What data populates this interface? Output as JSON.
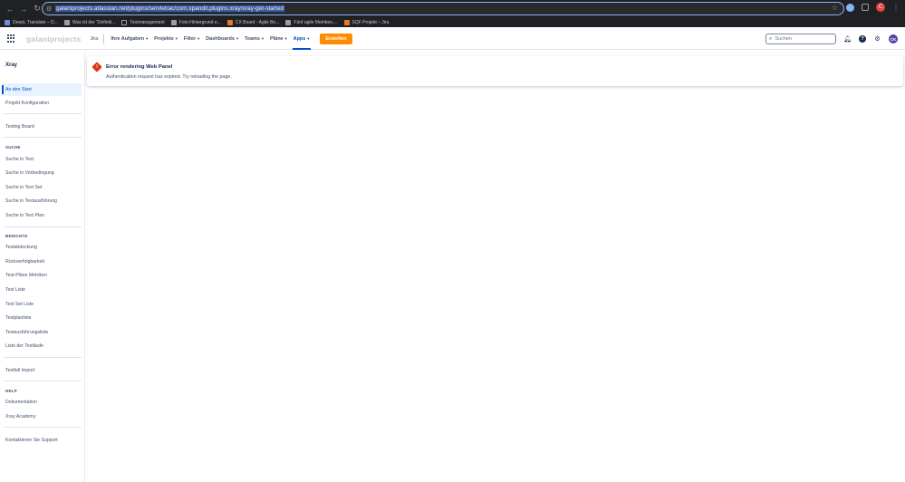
{
  "browser": {
    "url": "galaniprojects.atlassian.net/plugins/servlet/ac/com.xpandit.plugins.xray/xray-get-started",
    "profile_initial": "C",
    "bookmarks": [
      {
        "label": "DeepL Translate – D...",
        "icon": "deepl-icon"
      },
      {
        "label": "Was ist der \"Definiti...",
        "icon": "page-icon"
      },
      {
        "label": "Testmanagement",
        "icon": "folder-icon"
      },
      {
        "label": "Foto-Hintergrund e...",
        "icon": "scale-icon"
      },
      {
        "label": "CX Board - Agile Bo...",
        "icon": "jira-icon"
      },
      {
        "label": "Fünf agile Metriken,...",
        "icon": "page-icon"
      },
      {
        "label": "SQF Projekt – Jira",
        "icon": "jira-icon"
      }
    ]
  },
  "header": {
    "brand": "galaniprojects",
    "product": "Jira",
    "menu": [
      {
        "label": "Ihre Aufgaben",
        "active": false
      },
      {
        "label": "Projekte",
        "active": false
      },
      {
        "label": "Filter",
        "active": false
      },
      {
        "label": "Dashboards",
        "active": false
      },
      {
        "label": "Teams",
        "active": false
      },
      {
        "label": "Pläne",
        "active": false
      },
      {
        "label": "Apps",
        "active": true
      }
    ],
    "create_label": "Erstellen",
    "search_placeholder": "Suchen",
    "avatar_initials": "CK"
  },
  "sidebar": {
    "title": "Xray",
    "items_top": [
      {
        "label": "An den Start",
        "active": true
      },
      {
        "label": "Projekt Konfiguration"
      }
    ],
    "testing_board": "Testing Board",
    "search_heading": "SUCHE",
    "search_items": [
      "Suche in Test",
      "Suche in Vorbedingung",
      "Suche in Test Set",
      "Suche in Testausführung",
      "Suche in Test Plan"
    ],
    "reports_heading": "BERICHTE",
    "report_items": [
      "Testabdeckung",
      "Rückverfolgbarkeit",
      "Test-Pläne Metriken",
      "Test Liste",
      "Test Set Liste",
      "Testplanliste",
      "Testausführungsliste",
      "Liste der Testläufe"
    ],
    "import_item": "Testfall Import",
    "help_heading": "HELP",
    "help_items": [
      "Dokumentation",
      "Xray Academy"
    ],
    "support_item": "Kontaktieren Sie Support"
  },
  "error": {
    "title": "Error rendering Web Panel",
    "message": "Authentication request has expired. Try reloading the page."
  },
  "colors": {
    "accent": "#0052cc",
    "create_button": "#ff8b00",
    "error": "#de350b"
  }
}
